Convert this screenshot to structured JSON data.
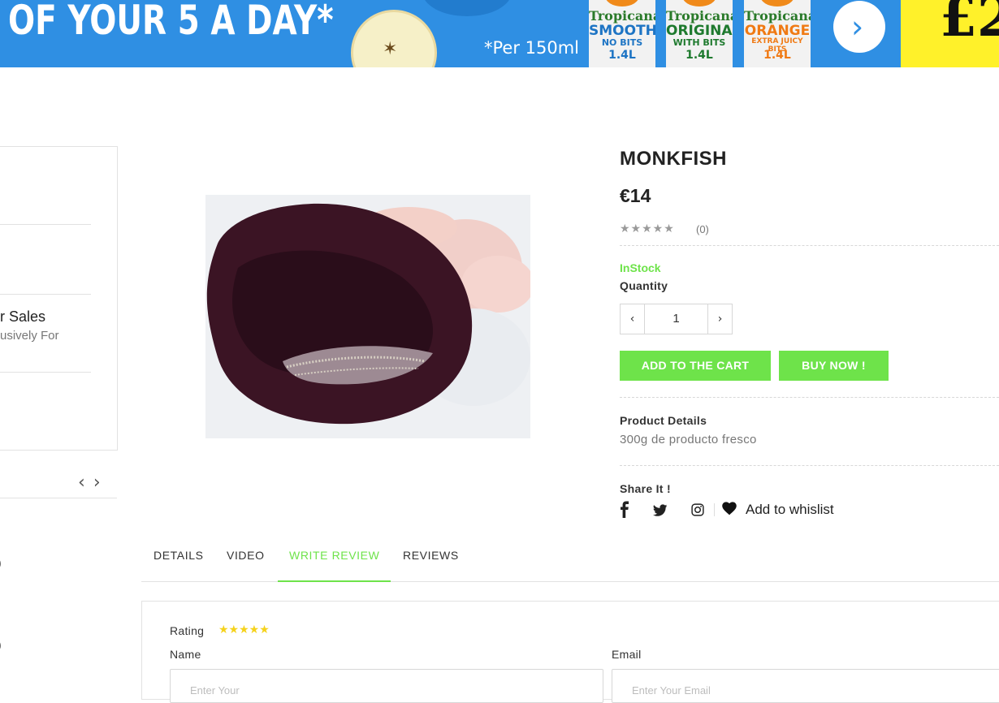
{
  "banner": {
    "headline": "OF YOUR 5 A DAY*",
    "per_note": "*Per 150ml",
    "cartons": [
      {
        "brand": "Tropicana",
        "kind": "SMOOTH",
        "sub": "NO BITS",
        "volume": "1.4L",
        "kind_color": "#1d74c4"
      },
      {
        "brand": "Tropicana",
        "kind": "ORIGINAL",
        "sub": "WITH BITS",
        "volume": "1.4L",
        "kind_color": "#1e7a2e"
      },
      {
        "brand": "Tropicana",
        "kind": "ORANGE",
        "sub": "EXTRA JUICY BITS",
        "volume": "1.4L",
        "kind_color": "#f07a14"
      }
    ],
    "next_arrow": "›",
    "price_fragment": "£2",
    "apple_star": "✶"
  },
  "sidebar": {
    "title_fragment": "r Sales",
    "subtitle_fragment": "usively For",
    "prev_arrow": "‹",
    "next_arrow": "›",
    "fragments": [
      ")",
      ")"
    ]
  },
  "product": {
    "title": "MONKFISH",
    "price": "€14",
    "rating_stars": "★★★★★",
    "rating_count": "(0)",
    "stock": "InStock",
    "quantity_label": "Quantity",
    "quantity_value": "1",
    "minus": "‹",
    "plus": "›",
    "add_to_cart": "ADD TO THE CART",
    "buy_now": "BUY NOW !",
    "details_label": "Product Details",
    "details_text": "300g de producto fresco",
    "share_label": "Share It !",
    "whislist": "Add to whislist"
  },
  "tabs": [
    {
      "label": "DETAILS"
    },
    {
      "label": "VIDEO"
    },
    {
      "label": "WRITE REVIEW"
    },
    {
      "label": "REVIEWS"
    }
  ],
  "review": {
    "rating_label": "Rating",
    "stars": "★★★★★",
    "name_label": "Name",
    "email_label": "Email",
    "name_placeholder": "Enter Your",
    "email_placeholder": "Enter Your Email"
  },
  "colors": {
    "accent_green": "#6ee34a",
    "banner_blue": "#2f8fe3",
    "banner_yellow": "#fff12a",
    "star_yellow": "#f5d21b"
  }
}
